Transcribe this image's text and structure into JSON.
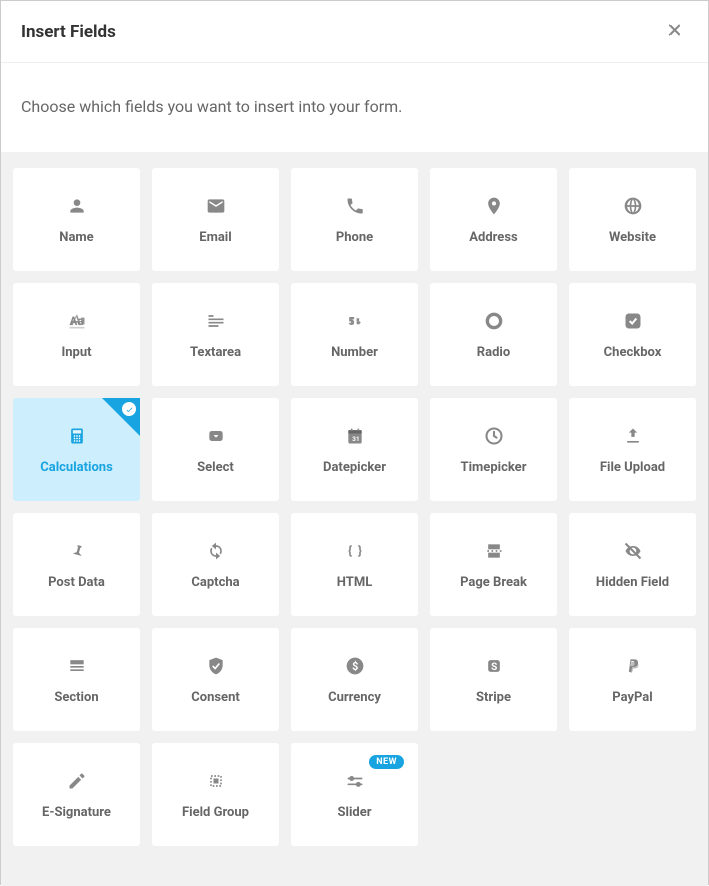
{
  "header": {
    "title": "Insert Fields"
  },
  "intro": {
    "text": "Choose which fields you want to insert into your form."
  },
  "badge": {
    "new": "NEW"
  },
  "fields": [
    {
      "id": "name",
      "label": "Name",
      "icon": "user",
      "selected": false
    },
    {
      "id": "email",
      "label": "Email",
      "icon": "mail",
      "selected": false
    },
    {
      "id": "phone",
      "label": "Phone",
      "icon": "phone",
      "selected": false
    },
    {
      "id": "address",
      "label": "Address",
      "icon": "pin",
      "selected": false
    },
    {
      "id": "website",
      "label": "Website",
      "icon": "globe",
      "selected": false
    },
    {
      "id": "input",
      "label": "Input",
      "icon": "typeface",
      "selected": false
    },
    {
      "id": "textarea",
      "label": "Textarea",
      "icon": "paragraph",
      "selected": false
    },
    {
      "id": "number",
      "label": "Number",
      "icon": "number",
      "selected": false
    },
    {
      "id": "radio",
      "label": "Radio",
      "icon": "radio",
      "selected": false
    },
    {
      "id": "checkbox",
      "label": "Checkbox",
      "icon": "checkbox",
      "selected": false
    },
    {
      "id": "calculations",
      "label": "Calculations",
      "icon": "calculator",
      "selected": true
    },
    {
      "id": "select",
      "label": "Select",
      "icon": "dropdown",
      "selected": false
    },
    {
      "id": "datepicker",
      "label": "Datepicker",
      "icon": "calendar",
      "selected": false
    },
    {
      "id": "timepicker",
      "label": "Timepicker",
      "icon": "clock",
      "selected": false
    },
    {
      "id": "fileupload",
      "label": "File Upload",
      "icon": "upload",
      "selected": false
    },
    {
      "id": "postdata",
      "label": "Post Data",
      "icon": "pushpin",
      "selected": false
    },
    {
      "id": "captcha",
      "label": "Captcha",
      "icon": "refresh",
      "selected": false
    },
    {
      "id": "html",
      "label": "HTML",
      "icon": "braces",
      "selected": false
    },
    {
      "id": "pagebreak",
      "label": "Page Break",
      "icon": "pagebreak",
      "selected": false
    },
    {
      "id": "hiddenfield",
      "label": "Hidden Field",
      "icon": "eye-off",
      "selected": false
    },
    {
      "id": "section",
      "label": "Section",
      "icon": "section",
      "selected": false
    },
    {
      "id": "consent",
      "label": "Consent",
      "icon": "shield",
      "selected": false
    },
    {
      "id": "currency",
      "label": "Currency",
      "icon": "dollar",
      "selected": false
    },
    {
      "id": "stripe",
      "label": "Stripe",
      "icon": "stripe",
      "selected": false
    },
    {
      "id": "paypal",
      "label": "PayPal",
      "icon": "paypal",
      "selected": false
    },
    {
      "id": "esignature",
      "label": "E-Signature",
      "icon": "pencil",
      "selected": false
    },
    {
      "id": "fieldgroup",
      "label": "Field Group",
      "icon": "group",
      "selected": false
    },
    {
      "id": "slider",
      "label": "Slider",
      "icon": "slider",
      "selected": false,
      "badge": "new"
    }
  ]
}
